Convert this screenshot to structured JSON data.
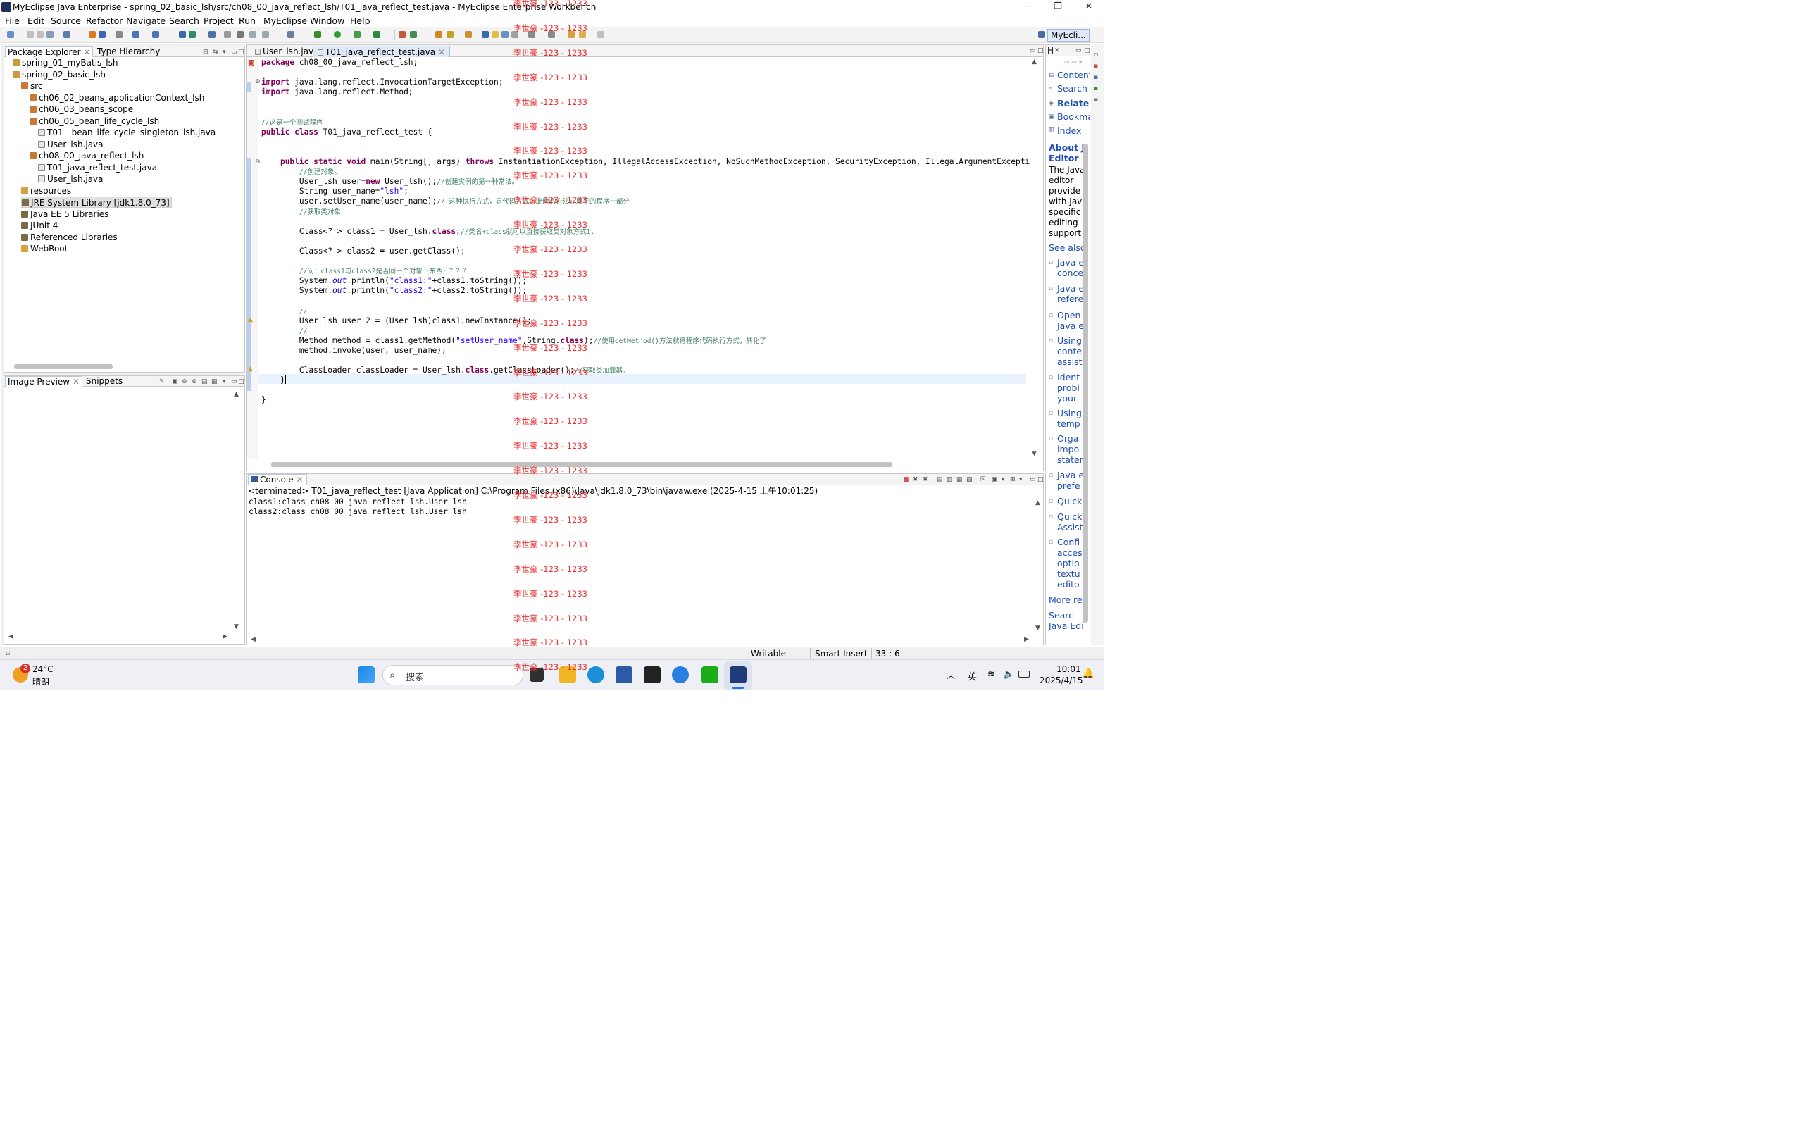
{
  "window": {
    "title": "MyEclipse Java Enterprise - spring_02_basic_lsh/src/ch08_00_java_reflect_lsh/T01_java_reflect_test.java - MyEclipse Enterprise Workbench",
    "minimize": "─",
    "maximize": "❐",
    "close": "✕"
  },
  "menu": [
    "File",
    "Edit",
    "Source",
    "Refactor",
    "Navigate",
    "Search",
    "Project",
    "Run",
    "MyEclipse",
    "Window",
    "Help"
  ],
  "perspective": {
    "label": "MyEcli..."
  },
  "package_explorer": {
    "tabs": [
      "Package Explorer",
      "Type Hierarchy"
    ],
    "tree": [
      {
        "label": "spring_01_myBatis_lsh",
        "icon": "project-icon"
      },
      {
        "label": "spring_02_basic_lsh",
        "icon": "project-icon"
      },
      {
        "label": "src",
        "icon": "source-folder-icon"
      },
      {
        "label": "ch06_02_beans_applicationContext_lsh",
        "icon": "package-icon"
      },
      {
        "label": "ch06_03_beans_scope",
        "icon": "package-icon"
      },
      {
        "label": "ch06_05_bean_life_cycle_lsh",
        "icon": "package-icon"
      },
      {
        "label": "T01__bean_life_cycle_singleton_lsh.java",
        "icon": "java-file-icon"
      },
      {
        "label": "User_lsh.java",
        "icon": "java-file-icon"
      },
      {
        "label": "ch08_00_java_reflect_lsh",
        "icon": "package-icon"
      },
      {
        "label": "T01_java_reflect_test.java",
        "icon": "java-file-icon"
      },
      {
        "label": "User_lsh.java",
        "icon": "java-file-icon"
      },
      {
        "label": "resources",
        "icon": "folder-icon"
      },
      {
        "label": "JRE System Library [jdk1.8.0_73]",
        "icon": "library-icon"
      },
      {
        "label": "Java EE 5 Libraries",
        "icon": "library-icon"
      },
      {
        "label": "JUnit 4",
        "icon": "library-icon"
      },
      {
        "label": "Referenced Libraries",
        "icon": "library-icon"
      },
      {
        "label": "WebRoot",
        "icon": "folder-icon"
      }
    ]
  },
  "image_preview": {
    "tabs": [
      "Image Preview",
      "Snippets"
    ]
  },
  "editor": {
    "tabs": [
      "User_lsh.java",
      "T01_java_reflect_test.java"
    ],
    "lines": [
      "package ch08_00_java_reflect_lsh;",
      "",
      "import java.lang.reflect.InvocationTargetException;",
      "import java.lang.reflect.Method;",
      "",
      "",
      "//这是一个测试程序",
      "public class T01_java_reflect_test {",
      "",
      "",
      "    public static void main(String[] args) throws InstantiationException, IllegalAccessException, NoSuchMethodException, SecurityException, IllegalArgumentExcepti",
      "        //创建对象。",
      "        User_lsh user=new User_lsh();//创建实例的第一种常法。",
      "        String user_name=\"lsh\";",
      "        user.setUser_name(user_name);// 这种执行方式，是代码方式，此时的方法它属于的程序一部分",
      "        //获取类对象",
      "",
      "        Class<? > class1 = User_lsh.class;//类名+class就可以直接获取类对象方式1.",
      "",
      "        Class<? > class2 = user.getClass();",
      "",
      "        //问：class1与class2是否同一个对象（东西）？？？",
      "        System.out.println(\"class1:\"+class1.toString());",
      "        System.out.println(\"class2:\"+class2.toString());",
      "",
      "        //",
      "        User_lsh user_2 = (User_lsh)class1.newInstance();",
      "        //",
      "        Method method = class1.getMethod(\"setUser_name\",String.class);//使用getMethod()方法就将程序代码执行方式，转化了",
      "        method.invoke(user, user_name);",
      "",
      "        ClassLoader classLoader = User_lsh.class.getClassLoader();//获取类加载器。",
      "    }",
      "",
      "}"
    ]
  },
  "console": {
    "tab": "Console",
    "header": "<terminated> T01_java_reflect_test [Java Application] C:\\Program Files (x86)\\Java\\jdk1.8.0_73\\bin\\javaw.exe (2025-4-15 上午10:01:25)",
    "output": [
      "class1:class ch08_00_java_reflect_lsh.User_lsh",
      "class2:class ch08_00_java_reflect_lsh.User_lsh"
    ]
  },
  "help": {
    "tab": "H",
    "links": [
      "Content",
      "Search",
      "Relatec",
      "Bookma",
      "Index"
    ],
    "about_title": "About J\nEditor",
    "about_text": "The Java\neditor\nprovide\nwith Jav\nspecific\nediting\nsupport",
    "see_also": "See also",
    "topics": [
      "Java e\nconce",
      "Java e\nrefere",
      "Open\nJava e",
      "Using\nconte\nassist",
      "Ident\nprobl\nyour",
      "Using\ntemp",
      "Orga\nimpo\nstater",
      "Java e\nprefe",
      "Quick",
      "Quick\nAssist",
      "Confi\nacces\noptio\ntextu\nedito"
    ],
    "more": "More re",
    "search_footer": "Searc\nJava Edi"
  },
  "status": {
    "writable": "Writable",
    "insert_mode": "Smart Insert",
    "position": "33 : 6"
  },
  "watermark": "李世豪 -123 - 1233",
  "taskbar": {
    "weather_temp": "24°C",
    "weather_desc": "晴朗",
    "weather_badge": "2",
    "search_placeholder": "搜索",
    "ime": "英",
    "time": "10:01",
    "date": "2025/4/15"
  },
  "colors": {
    "keyword": "#7f0055",
    "string": "#2a00ff",
    "comment": "#3f7f5f",
    "field": "#0000c0",
    "watermark": "#ee3030",
    "link": "#1e4fb4"
  }
}
